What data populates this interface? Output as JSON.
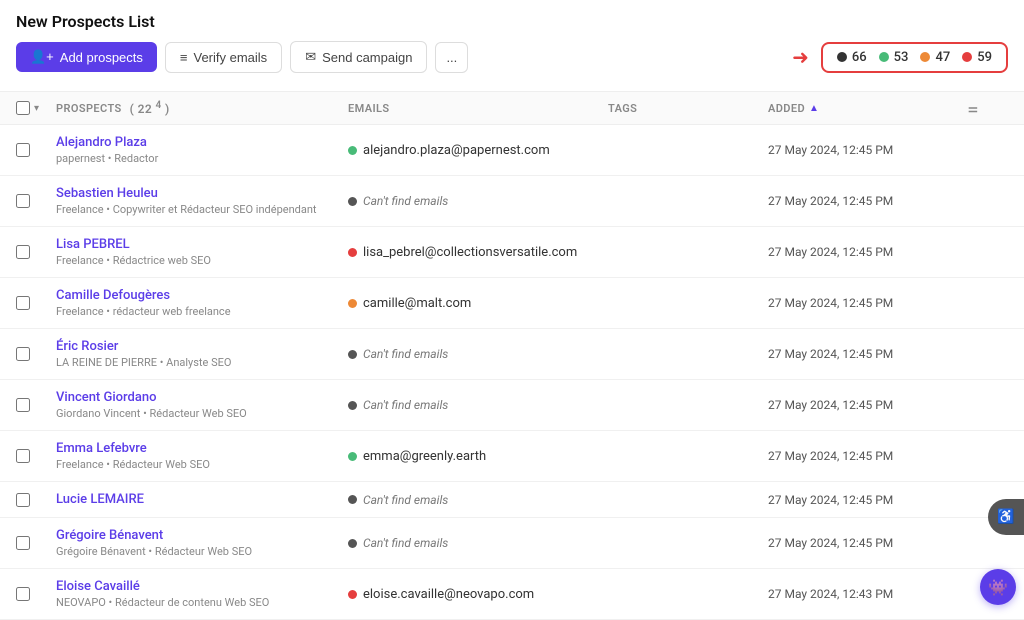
{
  "page": {
    "title": "New Prospects List"
  },
  "toolbar": {
    "add_prospects_label": "Add prospects",
    "verify_emails_label": "Verify emails",
    "send_campaign_label": "Send campaign",
    "more_label": "..."
  },
  "stats": {
    "dark_count": "66",
    "green_count": "53",
    "orange_count": "47",
    "red_count": "59"
  },
  "table": {
    "headers": {
      "prospects_label": "PROSPECTS",
      "prospects_count": "22",
      "prospects_sub": "4",
      "emails_label": "EMAILS",
      "tags_label": "TAGS",
      "added_label": "ADDED"
    },
    "rows": [
      {
        "name": "Alejandro Plaza",
        "company": "papernest",
        "role": "Redactor",
        "email": "alejandro.plaza@papernest.com",
        "email_status": "green",
        "tags": "",
        "added": "27 May 2024, 12:45 PM"
      },
      {
        "name": "Sebastien Heuleu",
        "company": "Freelance",
        "role": "Copywriter et Rédacteur SEO indépendant",
        "email": "Can't find emails",
        "email_status": "dark",
        "tags": "",
        "added": "27 May 2024, 12:45 PM"
      },
      {
        "name": "Lisa PEBREL",
        "company": "Freelance",
        "role": "Rédactrice web SEO",
        "email": "lisa_pebrel@collectionsversatile.com",
        "email_status": "red",
        "tags": "",
        "added": "27 May 2024, 12:45 PM"
      },
      {
        "name": "Camille Defougères",
        "company": "Freelance",
        "role": "rédacteur web freelance",
        "email": "camille@malt.com",
        "email_status": "orange",
        "tags": "",
        "added": "27 May 2024, 12:45 PM"
      },
      {
        "name": "Éric Rosier",
        "company": "LA REINE DE PIERRE",
        "role": "Analyste SEO",
        "email": "Can't find emails",
        "email_status": "dark",
        "tags": "",
        "added": "27 May 2024, 12:45 PM"
      },
      {
        "name": "Vincent Giordano",
        "company": "Giordano Vincent",
        "role": "Rédacteur Web SEO",
        "email": "Can't find emails",
        "email_status": "dark",
        "tags": "",
        "added": "27 May 2024, 12:45 PM"
      },
      {
        "name": "Emma Lefebvre",
        "company": "Freelance",
        "role": "Rédacteur Web SEO",
        "email": "emma@greenly.earth",
        "email_status": "green",
        "tags": "",
        "added": "27 May 2024, 12:45 PM"
      },
      {
        "name": "Lucie LEMAIRE",
        "company": "",
        "role": "",
        "email": "Can't find emails",
        "email_status": "dark",
        "tags": "",
        "added": "27 May 2024, 12:45 PM"
      },
      {
        "name": "Grégoire Bénavent",
        "company": "Grégoire Bénavent",
        "role": "Rédacteur Web SEO",
        "email": "Can't find emails",
        "email_status": "dark",
        "tags": "",
        "added": "27 May 2024, 12:45 PM"
      },
      {
        "name": "Eloise Cavaillé",
        "company": "NEOVAPO",
        "role": "Rédacteur de contenu Web SEO",
        "email": "eloise.cavaille@neovapo.com",
        "email_status": "red",
        "tags": "",
        "added": "27 May 2024, 12:43 PM"
      }
    ]
  }
}
